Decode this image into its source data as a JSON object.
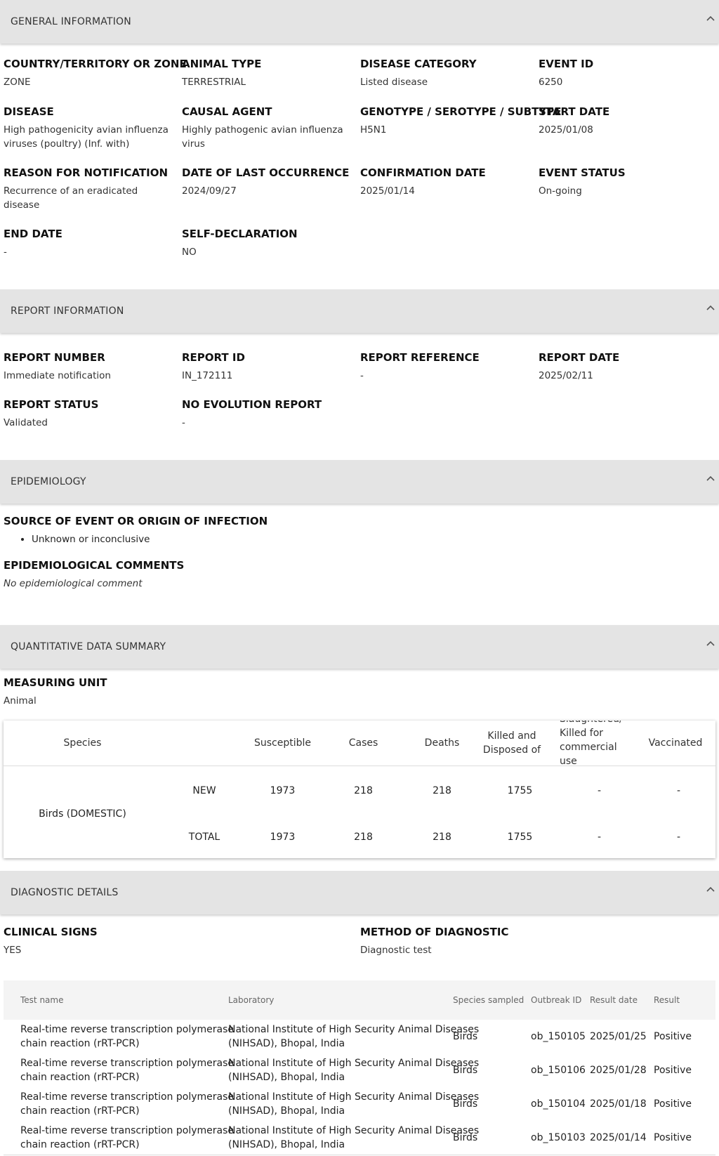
{
  "general": {
    "title": "GENERAL INFORMATION",
    "fields": [
      {
        "label": "COUNTRY/TERRITORY OR ZONE",
        "value": "ZONE"
      },
      {
        "label": "ANIMAL TYPE",
        "value": "TERRESTRIAL"
      },
      {
        "label": "DISEASE CATEGORY",
        "value": "Listed disease"
      },
      {
        "label": "EVENT ID",
        "value": "6250"
      },
      {
        "label": "DISEASE",
        "value": "High pathogenicity avian influenza\nviruses (poultry) (Inf. with)"
      },
      {
        "label": "CAUSAL AGENT",
        "value": "Highly pathogenic avian influenza\nvirus"
      },
      {
        "label": "GENOTYPE / SEROTYPE / SUBTYPE",
        "value": "H5N1"
      },
      {
        "label": "START DATE",
        "value": "2025/01/08"
      },
      {
        "label": "REASON FOR NOTIFICATION",
        "value": "Recurrence of an eradicated\ndisease"
      },
      {
        "label": "DATE OF LAST OCCURRENCE",
        "value": "2024/09/27"
      },
      {
        "label": "CONFIRMATION DATE",
        "value": "2025/01/14"
      },
      {
        "label": "EVENT STATUS",
        "value": "On-going"
      },
      {
        "label": "END DATE",
        "value": "-"
      },
      {
        "label": "SELF-DECLARATION",
        "value": "NO"
      }
    ]
  },
  "report": {
    "title": "REPORT INFORMATION",
    "fields": [
      {
        "label": "REPORT NUMBER",
        "value": "Immediate notification"
      },
      {
        "label": "REPORT ID",
        "value": "IN_172111"
      },
      {
        "label": "REPORT REFERENCE",
        "value": "-"
      },
      {
        "label": "REPORT DATE",
        "value": "2025/02/11"
      },
      {
        "label": "REPORT STATUS",
        "value": "Validated"
      },
      {
        "label": "NO EVOLUTION REPORT",
        "value": "-"
      }
    ]
  },
  "epidemiology": {
    "title": "EPIDEMIOLOGY",
    "source_label": "SOURCE OF EVENT OR ORIGIN OF INFECTION",
    "source_items": [
      "Unknown or inconclusive"
    ],
    "comments_label": "EPIDEMIOLOGICAL COMMENTS",
    "comments_value": "No epidemiological comment"
  },
  "quantitative": {
    "title": "QUANTITATIVE DATA SUMMARY",
    "measuring_unit_label": "MEASURING UNIT",
    "measuring_unit_value": "Animal",
    "headers": {
      "species": "Species",
      "susceptible": "Susceptible",
      "cases": "Cases",
      "deaths": "Deaths",
      "killed_line1": "Killed and",
      "killed_line2": "Disposed of",
      "slaughtered_line1": "Slaughtered/",
      "slaughtered_line2": "Killed for",
      "slaughtered_line3": "commercial",
      "slaughtered_line4": "use",
      "vaccinated": "Vaccinated"
    },
    "species": "Birds (DOMESTIC)",
    "rows": [
      {
        "type": "NEW",
        "susceptible": "1973",
        "cases": "218",
        "deaths": "218",
        "killed": "1755",
        "slaughtered": "-",
        "vaccinated": "-"
      },
      {
        "type": "TOTAL",
        "susceptible": "1973",
        "cases": "218",
        "deaths": "218",
        "killed": "1755",
        "slaughtered": "-",
        "vaccinated": "-"
      }
    ]
  },
  "diagnostic": {
    "title": "DIAGNOSTIC DETAILS",
    "clinical_signs_label": "CLINICAL SIGNS",
    "clinical_signs_value": "YES",
    "method_label": "METHOD OF DIAGNOSTIC",
    "method_value": "Diagnostic test",
    "table_headers": {
      "test_name": "Test name",
      "laboratory": "Laboratory",
      "species_sampled": "Species sampled",
      "outbreak_id": "Outbreak ID",
      "result_date": "Result date",
      "result": "Result"
    },
    "rows": [
      {
        "test_line1": "Real-time reverse transcription polymerase",
        "test_line2": "chain reaction (rRT-PCR)",
        "lab_line1": "National Institute of High Security Animal Diseases",
        "lab_line2": "(NIHSAD), Bhopal, India",
        "species": "Birds",
        "outbreak_id": "ob_150105",
        "result_date": "2025/01/25",
        "result": "Positive"
      },
      {
        "test_line1": "Real-time reverse transcription polymerase",
        "test_line2": "chain reaction (rRT-PCR)",
        "lab_line1": "National Institute of High Security Animal Diseases",
        "lab_line2": "(NIHSAD), Bhopal, India",
        "species": "Birds",
        "outbreak_id": "ob_150106",
        "result_date": "2025/01/28",
        "result": "Positive"
      },
      {
        "test_line1": "Real-time reverse transcription polymerase",
        "test_line2": "chain reaction (rRT-PCR)",
        "lab_line1": "National Institute of High Security Animal Diseases",
        "lab_line2": "(NIHSAD), Bhopal, India",
        "species": "Birds",
        "outbreak_id": "ob_150104",
        "result_date": "2025/01/18",
        "result": "Positive"
      },
      {
        "test_line1": "Real-time reverse transcription polymerase",
        "test_line2": "chain reaction (rRT-PCR)",
        "lab_line1": "National Institute of High Security Animal Diseases",
        "lab_line2": "(NIHSAD), Bhopal, India",
        "species": "Birds",
        "outbreak_id": "ob_150103",
        "result_date": "2025/01/14",
        "result": "Positive"
      }
    ]
  }
}
